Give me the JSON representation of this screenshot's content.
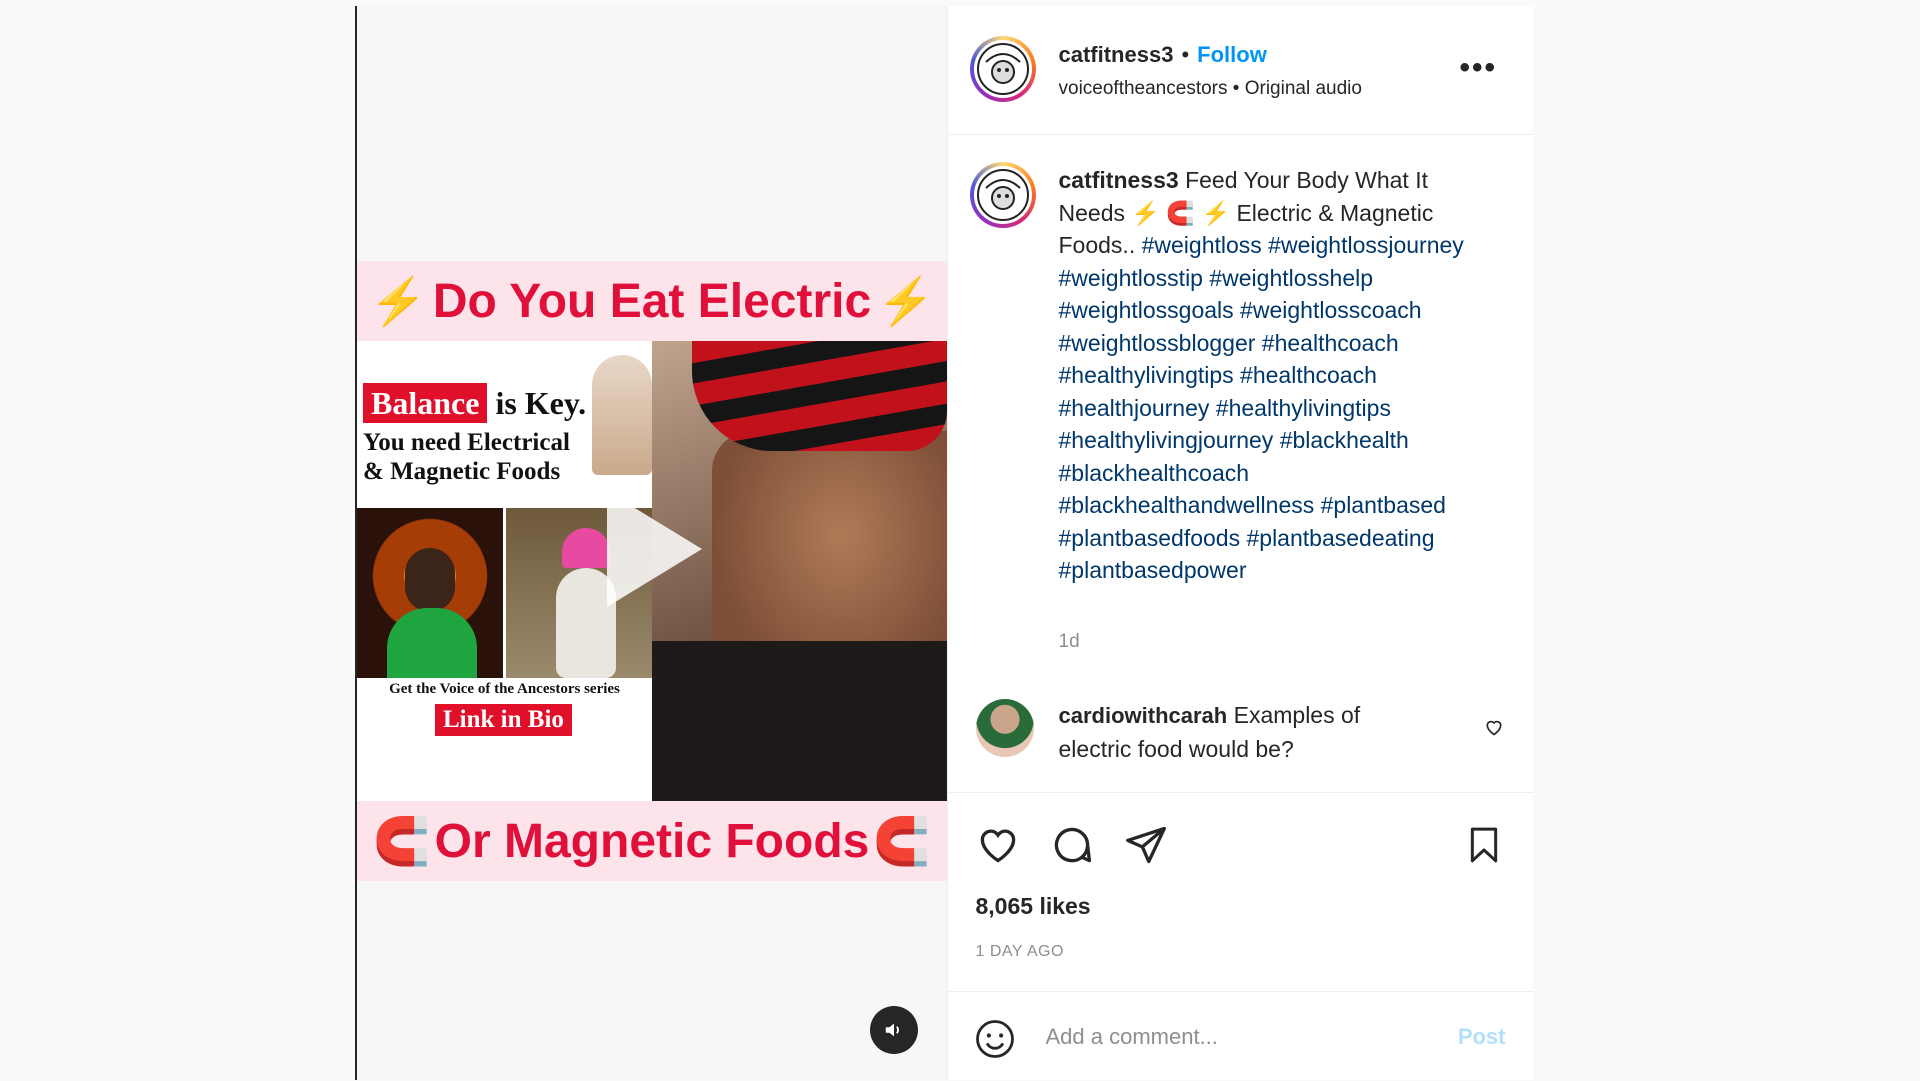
{
  "post": {
    "username": "catfitness3",
    "separator": "•",
    "follow_label": "Follow",
    "audio_artist": "voiceoftheancestors",
    "audio_separator": "•",
    "audio_label": "Original audio",
    "more_label": "•••",
    "avatar_text": "CAT FITNESS",
    "caption": {
      "username": "catfitness3",
      "text_part1": "Feed Your Body What It Needs",
      "emoji_bolt": "⚡",
      "emoji_magnet": "🧲",
      "text_part2": "Electric & Magnetic Foods..",
      "hashtags": "#weightloss #weightlossjourney #weightlosstip #weightlosshelp #weightlossgoals #weightlosscoach #weightlossblogger #healthcoach #healthylivingtips #healthcoach #healthjourney #healthylivingtips #healthylivingjourney #blackhealth #blackhealthcoach #blackhealthandwellness #plantbased #plantbasedfoods #plantbasedeating #plantbasedpower",
      "time": "1d"
    },
    "comment": {
      "username": "cardiowithcarah",
      "text": "Examples of electric food would be?"
    },
    "likes": "8,065 likes",
    "posted_ago": "1 DAY AGO",
    "add_comment_placeholder": "Add a comment...",
    "post_label": "Post"
  },
  "media": {
    "top_banner": "Do You Eat Electric",
    "bottom_banner": "Or Magnetic Foods",
    "balance_tag": "Balance",
    "balance_rest": "is Key.",
    "need_line1": "You need Electrical",
    "need_line2": "& Magnetic Foods",
    "series_text": "Get the Voice of the Ancestors series",
    "link_in_bio": "Link in Bio"
  },
  "colors": {
    "follow": "#0095f6",
    "hashtag": "#00376b",
    "banner_text": "#e0103a",
    "banner_bg": "#fde4ea"
  }
}
